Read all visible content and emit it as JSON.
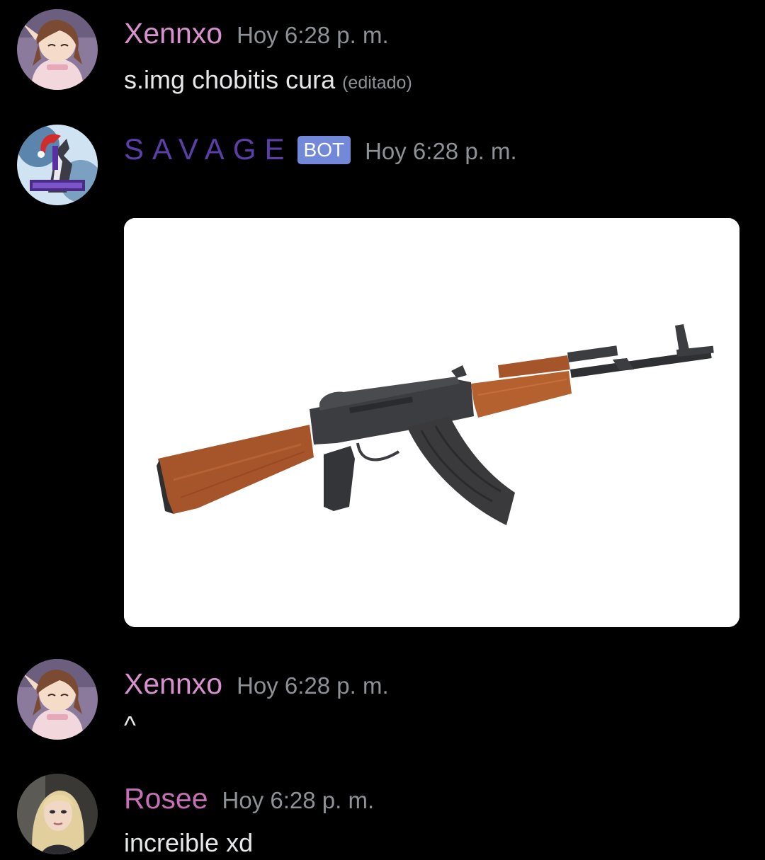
{
  "messages": [
    {
      "username": "Xennxo",
      "username_color": "#d890cf",
      "timestamp": "Hoy 6:28 p. m.",
      "text": "s.img chobitis cura",
      "edited_label": "(editado)"
    },
    {
      "username": "SAVAGE",
      "username_color": "#5b3ea8",
      "badge": "BOT",
      "timestamp": "Hoy 6:28 p. m."
    },
    {
      "username": "Xennxo",
      "username_color": "#d890cf",
      "timestamp": "Hoy 6:28 p. m.",
      "text": "^"
    },
    {
      "username": "Rosee",
      "username_color": "#c56fb5",
      "timestamp": "Hoy 6:28 p. m.",
      "text": "increible xd"
    }
  ],
  "icons": {
    "avatar_xennxo": "anime-girl-avatar",
    "avatar_savage": "howling-wolf-santa-hat-avatar",
    "avatar_rosee": "blonde-woman-avatar",
    "embed": "rifle-image"
  },
  "colors": {
    "background": "#000000",
    "timestamp": "#8e9297",
    "bot_badge": "#7289da"
  }
}
